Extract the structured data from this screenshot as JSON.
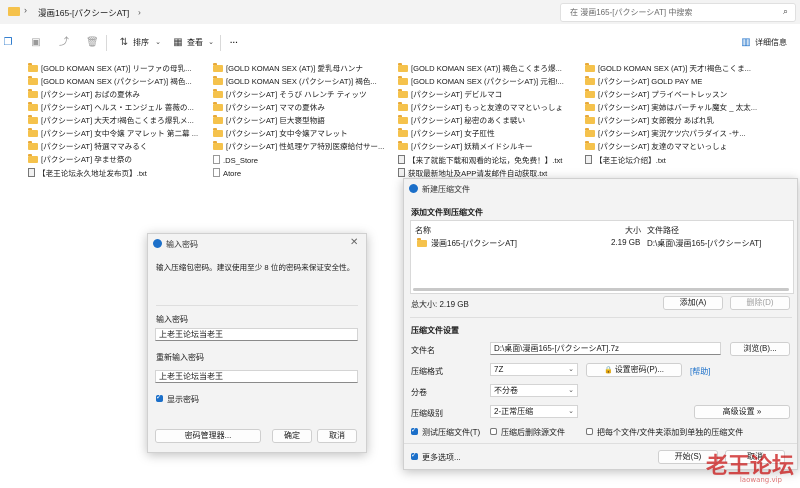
{
  "breadcrumb": {
    "current": "漫画165-[パクシーシAT]"
  },
  "search": {
    "placeholder": "在 漫画165-[パクシーシAT] 中搜索"
  },
  "toolbar": {
    "sort_label": "排序",
    "view_label": "查看",
    "more_label": "···",
    "details_label": "详细信息"
  },
  "files": {
    "col1": [
      "[GOLD KOMAN SEX (AT)] リーファの母乳...",
      "[GOLD KOMAN SEX (パクシーシAT)] 褐色...",
      "[パクシーシAT] おばの夏休み",
      "[パクシーシAT] ヘルス・エンジェル 蔷薇の...",
      "[パクシーシAT] 大天才!褐色こくまろ爆乳メ...",
      "[パクシーシAT] 女中令嬢 アマレット 第二幕 ...",
      "[パクシーシAT] 特選ママみるく",
      "[パクシーシAT] 孕ませ祭の",
      "【老王论坛永久地址发布页】.txt"
    ],
    "col2": [
      "[GOLD KOMAN SEX (AT)] 愛乳母ハンナ",
      "[GOLD KOMAN SEX (パクシーシAT)] 褐色...",
      "[パクシーシAT] そうび ハレンチ ティッツ",
      "[パクシーシAT] ママの夏休み",
      "[パクシーシAT] 巨大褒型物語",
      "[パクシーシAT] 女中令嬢アマレット",
      "[パクシーシAT] 性処理ケア特別医療給付サー...",
      ".DS_Store",
      "Atore"
    ],
    "col3": [
      "[GOLD KOMAN SEX (AT)] 褐色こくまろ爆...",
      "[GOLD KOMAN SEX (パクシーシAT)] 元祖!...",
      "[パクシーシAT] デビルマコ",
      "[パクシーシAT] もっと友達のママといっしょ",
      "[パクシーシAT] 秘密のあくま襞い",
      "[パクシーシAT] 女子肛性",
      "[パクシーシAT] 妖精メイドシルキー",
      "【来了就能下载和观看的论坛，免免费！】.txt",
      "获取最新地址及APP请发邮件自动获取.txt"
    ],
    "col4": [
      "[GOLD KOMAN SEX (AT)] 天才!褐色こくま...",
      "[パクシーシAT] GOLD PAY ME",
      "[パクシーシAT] プライベートレッスン",
      "[パクシーシAT] 実姉はバーチャル魔女 _ 太太...",
      "[パクシーシAT] 女郎親分 あばれ乳",
      "[パクシーシAT] 実況ケツ穴パラダイス -サ...",
      "[パクシーシAT] 友達のママといっしょ",
      "【老王论坛介绍】.txt"
    ]
  },
  "password_dialog": {
    "title": "输入密码",
    "message": "输入压缩包密码。建议使用至少 8 位的密码来保证安全性。",
    "password_label": "输入密码",
    "password_value": "上老王论坛当老王",
    "confirm_label": "重新输入密码",
    "confirm_value": "上老王论坛当老王",
    "show_password": "显示密码",
    "manager_button": "密码管理器...",
    "ok_button": "确定",
    "cancel_button": "取消"
  },
  "archive_dialog": {
    "title": "新建压缩文件",
    "section_add": "添加文件到压缩文件",
    "col_name": "名称",
    "col_size": "大小",
    "col_path": "文件路径",
    "row_name": "漫画165-[パクシーシAT]",
    "row_size": "2.19 GB",
    "row_path": "D:\\桌面\\漫画165-[パクシーシAT]",
    "total_size": "总大小: 2.19 GB",
    "add_button": "添加(A)",
    "delete_button": "删除(D)",
    "section_settings": "压缩文件设置",
    "filename_label": "文件名",
    "filename_value": "D:\\桌面\\漫画165-[パクシーシAT].7z",
    "browse_button": "浏览(B)...",
    "format_label": "压缩格式",
    "format_value": "7Z",
    "set_password_button": "设置密码(P)...",
    "help_link": "[帮助]",
    "split_label": "分卷",
    "split_value": "不分卷",
    "level_label": "压缩级别",
    "level_value": "2-正常压缩",
    "advanced_button": "高级设置 »",
    "test_option": "测试压缩文件(T)",
    "delete_source_option": "压缩后删除源文件",
    "separate_option": "把每个文件/文件夹添加到单独的压缩文件",
    "more_options": "更多选项...",
    "start_button": "开始(S)",
    "cancel_button": "取消"
  },
  "watermark": {
    "text": "老王论坛",
    "url": "laowang.vip"
  },
  "colors": {
    "accent": "#1b6fc9",
    "folder": "#f5c24c",
    "watermark": "#c81414"
  }
}
